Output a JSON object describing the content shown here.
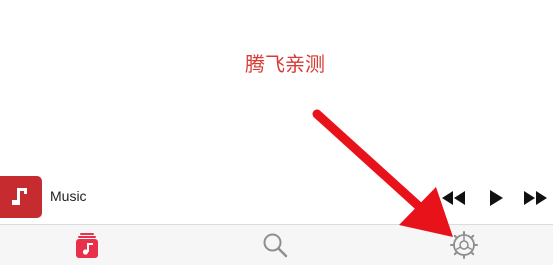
{
  "overlay": {
    "watermark_text": "腾飞亲测",
    "annotation": "red-arrow-pointing-to-settings-tab"
  },
  "now_playing": {
    "title": "Music",
    "artwork_icon": "music-note-icon",
    "controls": [
      {
        "name": "previous",
        "icon": "rewind-icon"
      },
      {
        "name": "play",
        "icon": "play-icon"
      },
      {
        "name": "next",
        "icon": "fast-forward-icon"
      }
    ]
  },
  "tab_bar": {
    "tabs": [
      {
        "name": "library",
        "icon": "music-library-icon",
        "active": true
      },
      {
        "name": "search",
        "icon": "search-icon",
        "active": false
      },
      {
        "name": "settings",
        "icon": "settings-gear-icon",
        "active": false
      }
    ]
  },
  "colors": {
    "accent": "#e8304a",
    "artwork": "#c52b2f",
    "annotation_red": "#e8121b",
    "watermark_red": "#d83a34",
    "inactive_icon": "#8e8e8e",
    "tab_bar_bg": "#f6f6f6"
  }
}
